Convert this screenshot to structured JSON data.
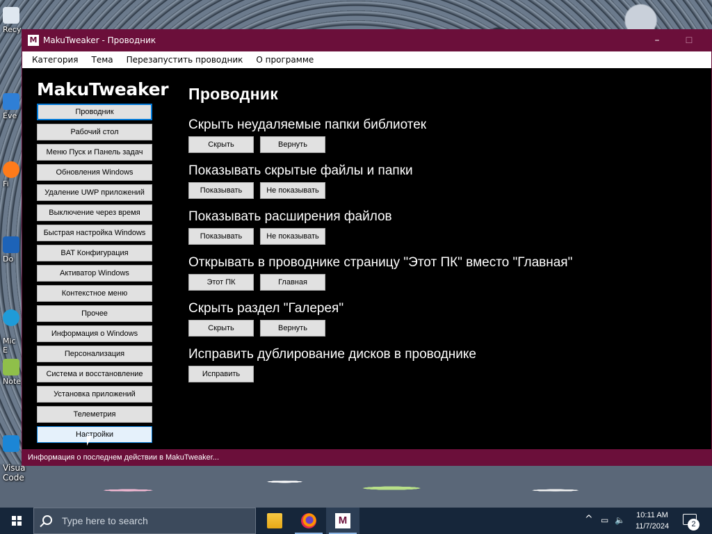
{
  "desktop": {
    "icons": [
      {
        "label": "Recy"
      },
      {
        "label": "Eve"
      },
      {
        "label": "Fi"
      },
      {
        "label": "Do"
      },
      {
        "label": "Mic\nE"
      },
      {
        "label": "Note"
      },
      {
        "label": "Visua\nCode"
      }
    ]
  },
  "window": {
    "app_icon": "M",
    "title": "MakuTweaker - Проводник",
    "min_icon": "–",
    "max_icon": "☐",
    "menu": [
      {
        "label": "Категория"
      },
      {
        "label": "Тема"
      },
      {
        "label": "Перезапустить проводник"
      },
      {
        "label": "О программе"
      }
    ],
    "brand": "MakuTweaker",
    "sidebar": [
      {
        "label": "Проводник"
      },
      {
        "label": "Рабочий стол"
      },
      {
        "label": "Меню Пуск и Панель задач"
      },
      {
        "label": "Обновления Windows"
      },
      {
        "label": "Удаление UWP приложений"
      },
      {
        "label": "Выключение через время"
      },
      {
        "label": "Быстрая настройка Windows"
      },
      {
        "label": "BAT Конфигурация"
      },
      {
        "label": "Активатор Windows"
      },
      {
        "label": "Контекстное меню"
      },
      {
        "label": "Прочее"
      },
      {
        "label": "Информация о Windows"
      },
      {
        "label": "Персонализация"
      },
      {
        "label": "Система и восстановление"
      },
      {
        "label": "Установка приложений"
      },
      {
        "label": "Телеметрия"
      },
      {
        "label": "Настройки"
      }
    ],
    "page_title": "Проводник",
    "sections": [
      {
        "title": "Скрыть неудаляемые папки библиотек",
        "buttons": [
          "Скрыть",
          "Вернуть"
        ]
      },
      {
        "title": "Показывать скрытые файлы и папки",
        "buttons": [
          "Показывать",
          "Не показывать"
        ]
      },
      {
        "title": "Показывать расширения файлов",
        "buttons": [
          "Показывать",
          "Не показывать"
        ]
      },
      {
        "title": "Открывать в проводнике страницу \"Этот ПК\" вместо \"Главная\"",
        "buttons": [
          "Этот ПК",
          "Главная"
        ]
      },
      {
        "title": "Скрыть раздел \"Галерея\"",
        "buttons": [
          "Скрыть",
          "Вернуть"
        ]
      },
      {
        "title": "Исправить дублирование дисков в проводнике",
        "buttons": [
          "Исправить"
        ]
      }
    ],
    "status": "Информация о последнем действии в MakuTweaker..."
  },
  "taskbar": {
    "search_placeholder": "Type here to search",
    "maku_glyph": "M",
    "tray": {
      "chevron": "^",
      "network": "▭",
      "volume": "🔈",
      "time": "10:11 AM",
      "date": "11/7/2024",
      "notification_count": "2"
    }
  },
  "colors": {
    "accent": "#6b0f3a",
    "focus": "#0078d7",
    "button_bg": "#e1e1e1",
    "taskbar": "#16263a"
  }
}
